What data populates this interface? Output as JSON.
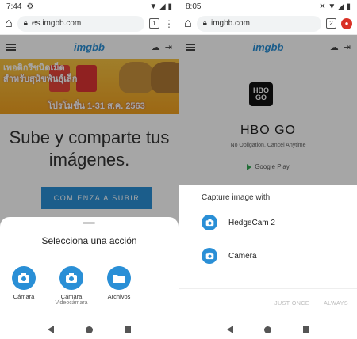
{
  "left_phone": {
    "status": {
      "time": "7:44",
      "icons": "▼ ◢ ▮"
    },
    "browser": {
      "url": "es.imgbb.com",
      "tab_count": "1"
    },
    "site": {
      "logo": "imgbb"
    },
    "banner": {
      "line1": "เพอดิกรีชนิดเม็ด",
      "line2": "สำหรับสุนัขพันธุ์เล็ก",
      "line3": "โปรโมชั่น 1-31 ส.ค. 2563"
    },
    "hero": {
      "title": "Sube y comparte tus imágenes.",
      "cta": "COMIENZA A SUBIR"
    },
    "sheet": {
      "title": "Selecciona una acción",
      "actions": [
        {
          "label": "Cámara",
          "sub": "",
          "icon": "camera-icon"
        },
        {
          "label": "Cámara",
          "sub": "Videocámara",
          "icon": "camera-icon"
        },
        {
          "label": "Archivos",
          "sub": "",
          "icon": "folder-icon"
        }
      ]
    }
  },
  "right_phone": {
    "status": {
      "time": "8:05",
      "icons": "✕ ▼ ◢ ▮"
    },
    "browser": {
      "url": "imgbb.com",
      "tab_count": "2"
    },
    "site": {
      "logo": "imgbb"
    },
    "app": {
      "logo_text": "HBO GO",
      "name": "HBO GO",
      "sub": "No Obligation. Cancel Anytime",
      "store": "Google Play"
    },
    "dialog": {
      "title": "Capture image with",
      "apps": [
        {
          "name": "HedgeCam 2",
          "icon": "camera-icon"
        },
        {
          "name": "Camera",
          "icon": "camera-icon"
        }
      ],
      "just_once": "JUST ONCE",
      "always": "ALWAYS"
    }
  },
  "colors": {
    "accent": "#2a8fd6",
    "scrim": "rgba(0,0,0,0.35)"
  }
}
